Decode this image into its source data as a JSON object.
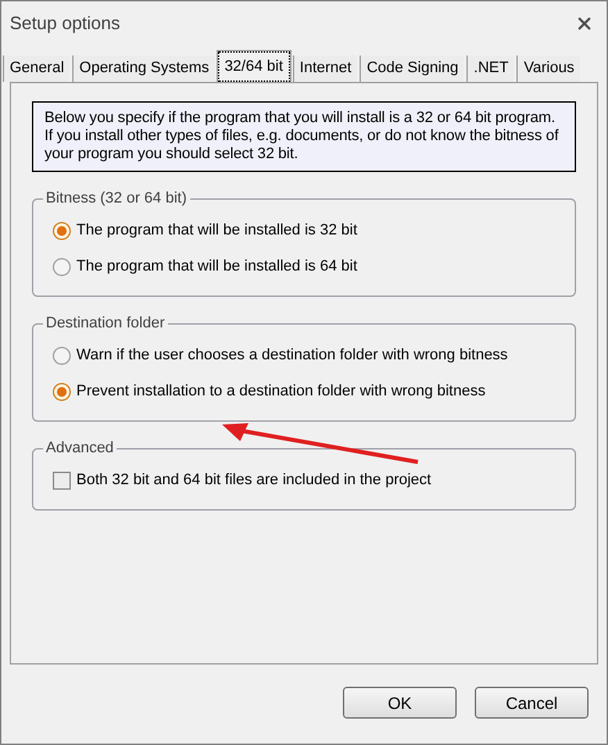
{
  "window": {
    "title": "Setup options"
  },
  "tabs": [
    {
      "label": "General",
      "selected": false
    },
    {
      "label": "Operating Systems",
      "selected": false
    },
    {
      "label": "32/64 bit",
      "selected": true
    },
    {
      "label": "Internet",
      "selected": false
    },
    {
      "label": "Code Signing",
      "selected": false
    },
    {
      "label": ".NET",
      "selected": false
    },
    {
      "label": "Various",
      "selected": false
    }
  ],
  "info": "Below you specify if the program that you will install is a 32 or 64 bit program. If you install other types of files, e.g. documents, or do not know the bitness of your program you should select 32 bit.",
  "groups": [
    {
      "title": "Bitness (32 or 64 bit)",
      "items": [
        {
          "kind": "radio",
          "label": "The program that will be installed is 32 bit",
          "selected": true
        },
        {
          "kind": "radio",
          "label": "The program that will be installed is 64 bit",
          "selected": false
        }
      ]
    },
    {
      "title": "Destination folder",
      "items": [
        {
          "kind": "radio",
          "label": "Warn if the user chooses a destination folder with wrong bitness",
          "selected": false
        },
        {
          "kind": "radio",
          "label": "Prevent installation to a destination folder with wrong bitness",
          "selected": true
        }
      ]
    },
    {
      "title": "Advanced",
      "items": [
        {
          "kind": "checkbox",
          "label": "Both 32 bit and 64 bit files are included in the project",
          "checked": false
        }
      ]
    }
  ],
  "buttons": [
    "OK",
    "Cancel"
  ]
}
